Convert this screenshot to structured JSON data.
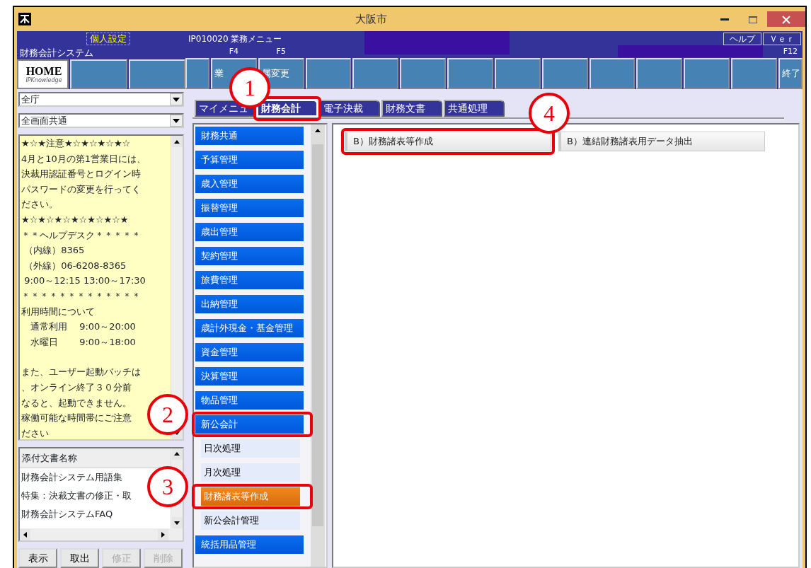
{
  "window": {
    "title": "大阪市"
  },
  "header": {
    "settings_button": "個人設定",
    "system_name": "財務会計システム",
    "screen_id": "IP010020 業務メニュー",
    "help_button": "ヘルプ",
    "version_button": "Ｖｅｒ"
  },
  "home_keys": [
    {
      "kind": "home",
      "label": "HOME",
      "caption": "IPKnowledge"
    },
    {
      "kind": "blank"
    },
    {
      "kind": "blank"
    }
  ],
  "function_keys": [
    {
      "kind": "narrow"
    },
    {
      "kind": "wide",
      "fkey": "F4",
      "label": "業"
    },
    {
      "kind": "wide",
      "fkey": "F5",
      "label": "属変更"
    },
    {
      "kind": "wide"
    },
    {
      "kind": "wide"
    },
    {
      "kind": "wide"
    },
    {
      "kind": "wide"
    },
    {
      "kind": "wide"
    },
    {
      "kind": "wide"
    },
    {
      "kind": "wide"
    },
    {
      "kind": "wide"
    },
    {
      "kind": "wide"
    },
    {
      "kind": "wide"
    },
    {
      "kind": "narrow",
      "fkey": "F12",
      "label": "終了"
    }
  ],
  "left_panel": {
    "department_select": "全庁",
    "category_select": "全画面共通",
    "notice_blocks": [
      [
        "★☆★注意★☆★☆★☆★☆",
        "4月と10月の第1営業日には、",
        "決裁用認証番号とログイン時",
        "パスワードの変更を行ってく",
        "ださい。",
        "★☆★☆★☆★☆★☆★☆★",
        "＊＊ヘルプデスク＊＊＊＊＊",
        " （内線）8365",
        " （外線）06-6208-8365",
        " 9:00～12:15 13:00～17:30",
        "＊＊＊＊＊＊＊＊＊＊＊＊＊",
        "利用時間について",
        "　通常利用　 9:00～20:00",
        "　水曜日　　 9:00～18:00"
      ],
      [
        "また、ユーザー起動バッチは",
        "、オンライン終了３０分前",
        "なると、起動できません。",
        "稼働可能な時間帯にご注意",
        "ださい"
      ]
    ],
    "attachments": {
      "header": "添付文書名称",
      "items": [
        "財務会計システム用語集",
        "特集：決裁文書の修正・取",
        "財務会計システムFAQ"
      ]
    },
    "actions": [
      {
        "label": "表示",
        "disabled": false
      },
      {
        "label": "取出",
        "disabled": false
      },
      {
        "label": "修正",
        "disabled": true
      },
      {
        "label": "削除",
        "disabled": true
      }
    ]
  },
  "tabs": [
    {
      "label": "マイメニュ",
      "selected": false
    },
    {
      "label": "財務会計",
      "selected": true,
      "callout": "1"
    },
    {
      "label": "電子決裁",
      "selected": false
    },
    {
      "label": "財務文書",
      "selected": false
    },
    {
      "label": "共通処理",
      "selected": false
    }
  ],
  "menu": [
    {
      "kind": "category",
      "label": "財務共通",
      "selected": false
    },
    {
      "kind": "category",
      "label": "予算管理",
      "selected": false
    },
    {
      "kind": "category",
      "label": "歳入管理",
      "selected": false
    },
    {
      "kind": "category",
      "label": "振替管理",
      "selected": false
    },
    {
      "kind": "category",
      "label": "歳出管理",
      "selected": false
    },
    {
      "kind": "category",
      "label": "契約管理",
      "selected": false
    },
    {
      "kind": "category",
      "label": "旅費管理",
      "selected": false
    },
    {
      "kind": "category",
      "label": "出納管理",
      "selected": false
    },
    {
      "kind": "category",
      "label": "歳計外現金・基金管理",
      "selected": false
    },
    {
      "kind": "category",
      "label": "資金管理",
      "selected": false
    },
    {
      "kind": "category",
      "label": "決算管理",
      "selected": false
    },
    {
      "kind": "category",
      "label": "物品管理",
      "selected": false
    },
    {
      "kind": "category",
      "label": "新公会計",
      "selected": false,
      "callout": "2"
    },
    {
      "kind": "sub",
      "label": "日次処理",
      "selected": false
    },
    {
      "kind": "sub",
      "label": "月次処理",
      "selected": false
    },
    {
      "kind": "sub",
      "label": "財務諸表等作成",
      "selected": true,
      "callout": "3"
    },
    {
      "kind": "sub",
      "label": "新公会計管理",
      "selected": false
    },
    {
      "kind": "category",
      "label": "統括用品管理",
      "selected": false
    }
  ],
  "content_buttons": [
    {
      "label": "B）財務諸表等作成",
      "callout": "4"
    },
    {
      "label": "B）連結財務諸表用データ抽出"
    }
  ]
}
